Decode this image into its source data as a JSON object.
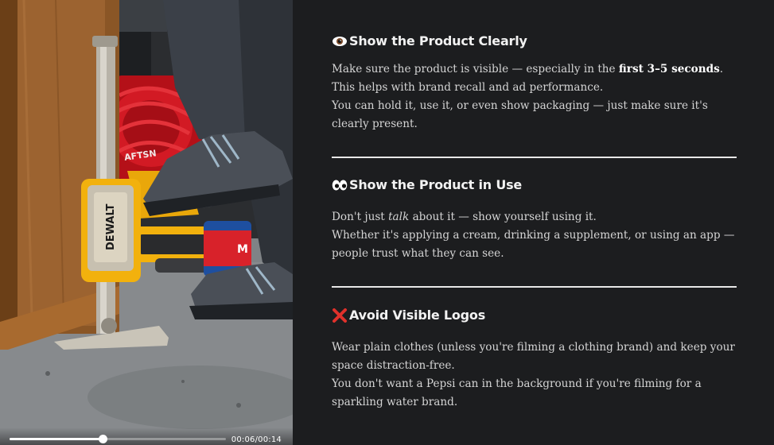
{
  "video": {
    "time_text": "00:06/00:14",
    "progress_fraction": 0.43,
    "scene": {
      "product_label": "DEWALT",
      "hose_label": "AFTSN",
      "can_label": "M"
    },
    "colors": {
      "wall": "#8a5a2b",
      "floor": "#7b7f82",
      "hose": "#c5151f",
      "boot": "#3e4247",
      "tool_yellow": "#f2b10d"
    }
  },
  "sections": [
    {
      "icon": "eye-icon",
      "title": "Show the Product Clearly",
      "body_before_bold": "Make sure the product is visible — especially in the ",
      "body_bold": "first 3–5 seconds",
      "body_after_bold": ". This helps with brand recall and ad performance.",
      "body_line2": "You can hold it, use it, or even show packaging — just make sure it's clearly present."
    },
    {
      "icon": "eyes-icon",
      "title": "Show the Product in Use",
      "body_before_italic": "Don't just ",
      "body_italic": "talk",
      "body_after_italic": " about it — show yourself using it.",
      "body_line2": "Whether it's applying a cream, drinking a supplement, or using an app — people trust what they can see."
    },
    {
      "icon": "red-x-icon",
      "title": "Avoid Visible Logos",
      "body_line1": "Wear plain clothes (unless you're filming a clothing brand) and keep your space distraction-free.",
      "body_line2": "You don't want a Pepsi can in the background if you're filming for a sparkling water brand."
    }
  ],
  "theme": {
    "background": "#1c1d1f",
    "heading_color": "#f2f2f2",
    "text_color": "#d4d4d4",
    "divider_color": "#e8e8e8",
    "accent_red": "#e0312b"
  }
}
